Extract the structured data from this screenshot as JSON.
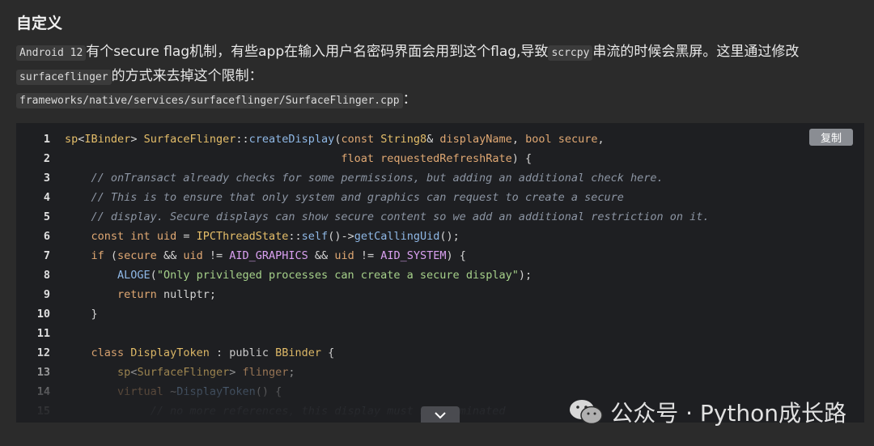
{
  "heading": "自定义",
  "paragraph": {
    "code1": "Android 12",
    "text1": "有个secure flag机制，有些app在输入用户名密码界面会用到这个flag,导致",
    "code2": "scrcpy",
    "text2": "串流的时候会黑屏。这里通过修改",
    "code3": "surfaceflinger",
    "text3": "的方式来去掉这个限制："
  },
  "path": {
    "code": "frameworks/native/services/surfaceflinger/SurfaceFlinger.cpp",
    "suffix": "："
  },
  "code_block": {
    "copy_label": "复制",
    "expand_label": "⌄",
    "line_numbers": [
      "1",
      "2",
      "3",
      "4",
      "5",
      "6",
      "7",
      "8",
      "9",
      "10",
      "11",
      "12",
      "13",
      "14",
      "15"
    ]
  },
  "watermark": "公众号 · Python成长路"
}
